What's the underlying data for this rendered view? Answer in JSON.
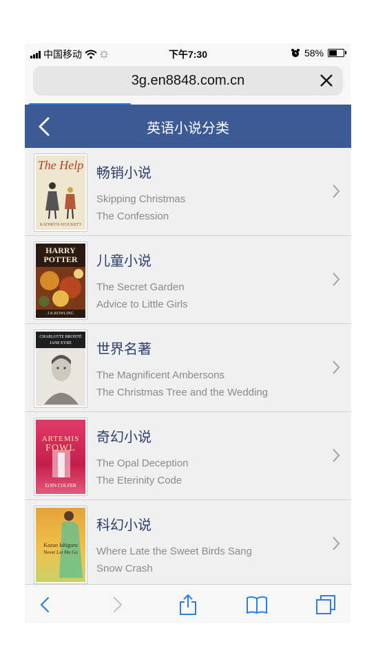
{
  "status_bar": {
    "carrier": "中国移动",
    "time": "下午7:30",
    "battery": "58%"
  },
  "browser": {
    "url": "3g.en8848.com.cn",
    "load_progress": 0.32
  },
  "header": {
    "title": "英语小说分类"
  },
  "categories": [
    {
      "name": "畅销小说",
      "books": [
        "Skipping Christmas",
        "The Confession"
      ],
      "cover": {
        "title": "The Help",
        "author": "KATHRYN STOCKETT"
      }
    },
    {
      "name": "儿童小说",
      "books": [
        "The Secret Garden",
        "Advice to Little Girls"
      ],
      "cover": {
        "title_line1": "HARRY",
        "title_line2": "POTTER",
        "author": "J.K.ROWLING"
      }
    },
    {
      "name": "世界名著",
      "books": [
        "The Magnificent Ambersons",
        "The Christmas Tree and the Wedding"
      ],
      "cover": {
        "author": "CHARLOTTE BRONTË",
        "title": "JANE EYRE"
      }
    },
    {
      "name": "奇幻小说",
      "books": [
        "The Opal Deception",
        "The Eterinity Code"
      ],
      "cover": {
        "title_line1": "ARTEMIS",
        "title_line2": "FOWL",
        "author": "EOIN COLFER"
      }
    },
    {
      "name": "科幻小说",
      "books": [
        "Where Late the Sweet Birds Sang",
        "Snow Crash"
      ],
      "cover": {
        "author": "Kazuo Ishiguro",
        "title": "Never Let Me Go"
      }
    }
  ],
  "colors": {
    "header_bg": "#3c5a96",
    "category_text": "#2b3f6b",
    "toolbar_icon": "#2a7ee8",
    "progress": "#2a7ee8"
  },
  "icons": {
    "back": "chevron-left-icon",
    "forward": "chevron-right-icon",
    "share": "share-icon",
    "bookmarks": "book-icon",
    "tabs": "tabs-icon",
    "close": "close-icon"
  }
}
